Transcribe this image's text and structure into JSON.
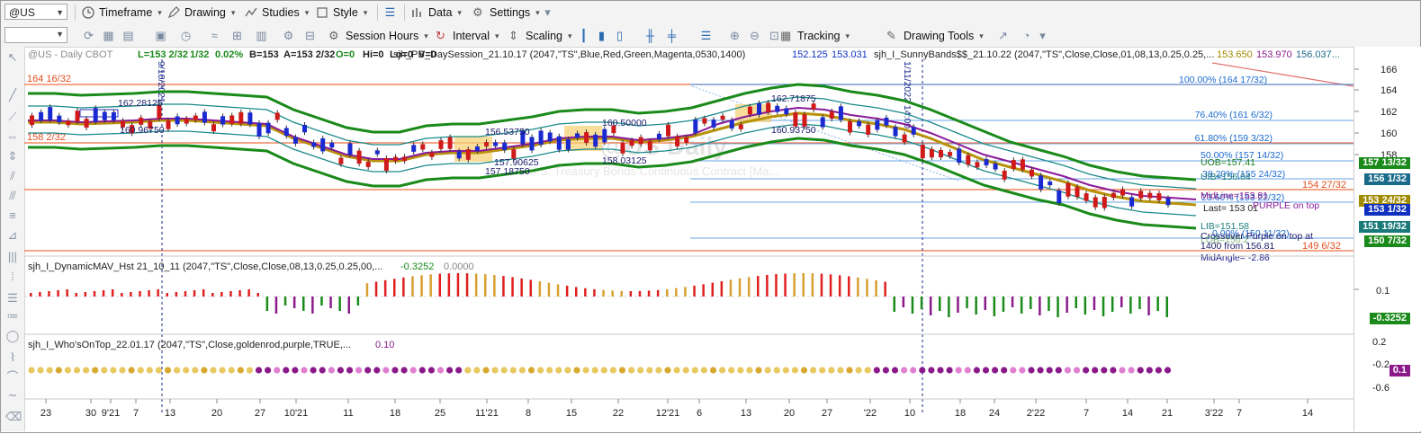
{
  "toolbar1": {
    "symbol": "@US",
    "items": [
      {
        "name": "timeframe-menu",
        "label": "Timeframe"
      },
      {
        "name": "drawing-menu",
        "label": "Drawing"
      },
      {
        "name": "studies-menu",
        "label": "Studies"
      },
      {
        "name": "style-menu",
        "label": "Style"
      },
      {
        "name": "data-menu",
        "label": "Data"
      },
      {
        "name": "settings-menu",
        "label": "Settings"
      }
    ]
  },
  "toolbar2": {
    "session_hours": "Session Hours",
    "interval": "Interval",
    "scaling": "Scaling",
    "tracking": "Tracking",
    "drawing_tools": "Drawing Tools"
  },
  "header": {
    "symbol_desc": "@US - Daily  CBOT",
    "stats": [
      {
        "text": "L=153 2/32",
        "color": "#1a8a1a"
      },
      {
        "text": "1/32",
        "color": "#1a8a1a"
      },
      {
        "text": "0.02%",
        "color": "#1a8a1a"
      },
      {
        "text": "B=153",
        "color": "#222"
      },
      {
        "text": "A=153 2/32",
        "color": "#222"
      },
      {
        "text": "O=0",
        "color": "#1a8a1a"
      },
      {
        "text": "Hi=0",
        "color": "#222"
      },
      {
        "text": "Lo=0",
        "color": "#222"
      },
      {
        "text": "V=0",
        "color": "#222"
      }
    ],
    "study1": "sjh_PB_DaySession_21.10.17 (2047,\"TS\",Blue,Red,Green,Magenta,0530,1400)",
    "study1_vals": [
      {
        "text": "152.125",
        "color": "#1030c0"
      },
      {
        "text": "153.031",
        "color": "#1030c0"
      }
    ],
    "study2": "sjh_I_SunnyBands$$_21.10.22 (2047,\"TS\",Close,Close,01,08,13,0.25,0.25,...",
    "study2_vals": [
      {
        "text": "153.650",
        "color": "#a08a00"
      },
      {
        "text": "153.970",
        "color": "#8a1a8a"
      },
      {
        "text": "156.037...",
        "color": "#1a6a8a"
      }
    ]
  },
  "chart_labels": {
    "level_164": "164 16/32",
    "level_158": "158 2/32",
    "level_154": "154 27/32",
    "level_149": "149 6/32",
    "fib_100": "100.00% (164 17/32)",
    "fib_764": "76.40% (161 6/32)",
    "fib_618": "61.80% (159 3/32)",
    "fib_50": "50.00% (157 14/32)",
    "fib_382": "38.20% (155 24/32)",
    "fib_236": "23.60% (153 22/32)",
    "fib_0": "0.00% (150 11/32)",
    "uob": "UOB=157.41",
    "uib": "UIB=156.04",
    "midline": "MidLine=153.81",
    "last": "Last=  153 01",
    "purple_on_top": "PURPLE on top",
    "lib": "LIB=151.58",
    "crossover": "Crossover Purple on top at",
    "from": "1400 from 156.81",
    "lob": "LOB=150.2",
    "midangle": "MidAngle= -2.86",
    "p1": "162.28125",
    "p2": "160.96750",
    "p3": "156.53750",
    "p4": "157.90625",
    "p5": "157.18750",
    "p6": "160.50000",
    "p7": "158.03125",
    "p8": "162.71875",
    "p9": "160.93750",
    "vdate1": "9/10/2021",
    "vdate2": "1/11/2022 14:00",
    "watermark": "@US Daily",
    "watermark2": "U.S. Treasury Bonds Continuous Contract [Ma..."
  },
  "price_axis": {
    "ticks": [
      "166",
      "164",
      "162",
      "160",
      "158"
    ],
    "tags": [
      {
        "text": "157 13/32",
        "color": "#1a7a1a"
      },
      {
        "text": "156 1/32",
        "color": "#1a6a8a"
      },
      {
        "text": "153 24/32",
        "color": "#a08a00"
      },
      {
        "text": "153 1/32",
        "color": "#1030c0"
      },
      {
        "text": "151 19/32",
        "color": "#1a7a7a"
      },
      {
        "text": "150 7/32",
        "color": "#1a7a1a"
      }
    ]
  },
  "panel2": {
    "title": "sjh_I_DynamicMAV_Hst 21_10_11 (2047,\"TS\",Close,Close,08,13,0.25,0.25,00,...",
    "val1": "-0.3252",
    "val2": "0.0000",
    "ticks": [
      "0.1",
      "-0.1"
    ],
    "tag": "-0.3252"
  },
  "panel3": {
    "title": "sjh_I_Who'sOnTop_22.01.17 (2047,\"TS\",Close,goldenrod,purple,TRUE,...",
    "val1": "0.10",
    "ticks": [
      "0.2",
      "-0.2",
      "-0.6"
    ],
    "tag": "0.1"
  },
  "time_axis": [
    "23",
    "30",
    "9'21",
    "7",
    "13",
    "20",
    "27",
    "10'21",
    "11",
    "18",
    "25",
    "11'21",
    "8",
    "15",
    "22",
    "12'21",
    "6",
    "13",
    "20",
    "27",
    "'22",
    "10",
    "18",
    "24",
    "2'22",
    "7",
    "14",
    "21",
    "3'22",
    "7",
    "14"
  ]
}
